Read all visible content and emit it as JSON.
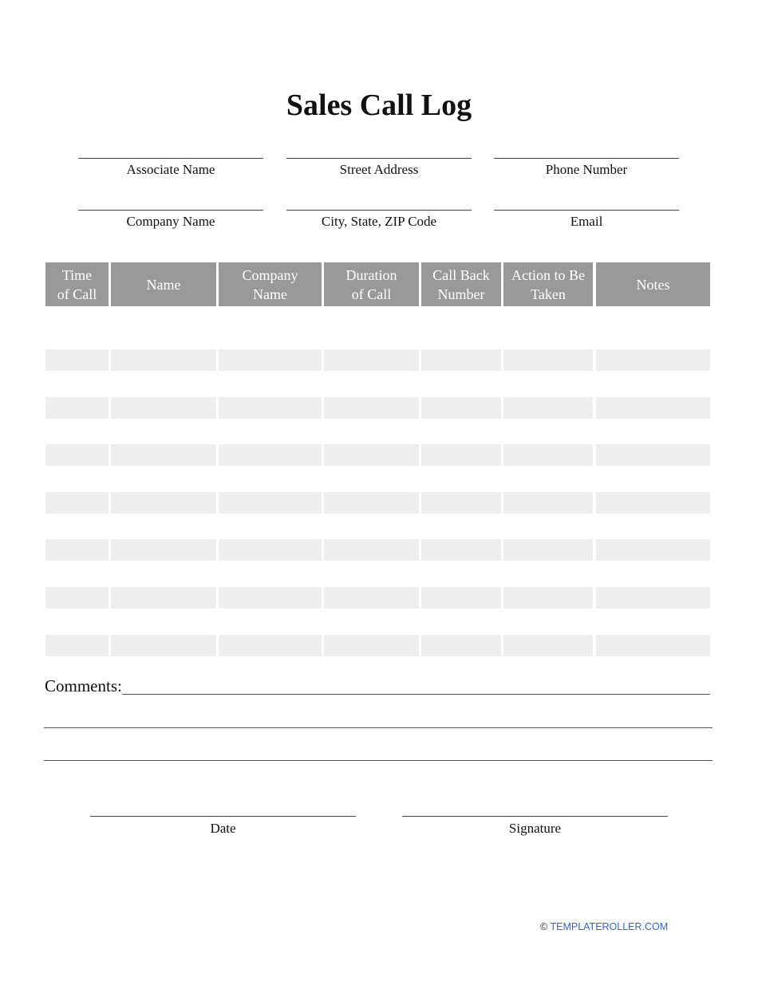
{
  "title": "Sales Call Log",
  "fields": [
    {
      "label": "Associate Name"
    },
    {
      "label": "Street Address"
    },
    {
      "label": "Phone Number"
    },
    {
      "label": "Company Name"
    },
    {
      "label": "City, State, ZIP Code"
    },
    {
      "label": "Email"
    }
  ],
  "table": {
    "columns": [
      {
        "line1": "Time",
        "line2": "of Call"
      },
      {
        "line1": "Name",
        "line2": ""
      },
      {
        "line1": "Company",
        "line2": "Name"
      },
      {
        "line1": "Duration",
        "line2": "of Call"
      },
      {
        "line1": "Call Back",
        "line2": "Number"
      },
      {
        "line1": "Action to Be",
        "line2": "Taken"
      },
      {
        "line1": "Notes",
        "line2": ""
      }
    ],
    "row_count": 14,
    "header_color": "#999999",
    "stripe_color": "#eeeeee"
  },
  "comments": {
    "label": "Comments:"
  },
  "signature_block": {
    "date_label": "Date",
    "signature_label": "Signature"
  },
  "footer": {
    "copyright": "©",
    "link": "TEMPLATEROLLER.COM",
    "link_color": "#3366cc"
  }
}
